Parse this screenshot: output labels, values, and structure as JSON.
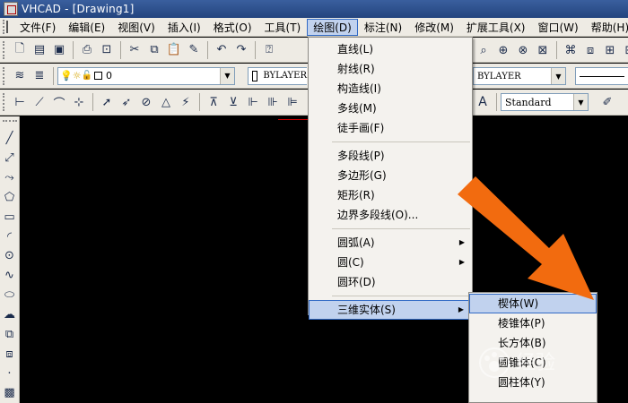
{
  "window": {
    "title": "VHCAD - [Drawing1]"
  },
  "menubar": {
    "items": [
      {
        "label": "文件(F)"
      },
      {
        "label": "编辑(E)"
      },
      {
        "label": "视图(V)"
      },
      {
        "label": "插入(I)"
      },
      {
        "label": "格式(O)"
      },
      {
        "label": "工具(T)"
      },
      {
        "label": "绘图(D)",
        "active": true
      },
      {
        "label": "标注(N)"
      },
      {
        "label": "修改(M)"
      },
      {
        "label": "扩展工具(X)"
      },
      {
        "label": "窗口(W)"
      },
      {
        "label": "帮助(H)"
      }
    ]
  },
  "toolbar2": {
    "layer_value": "0",
    "color_value": "BYLAYER",
    "linetype_value": "BYLAYER"
  },
  "toolbar3": {
    "textstyle_value": "Standard"
  },
  "draw_menu": {
    "items": [
      {
        "label": "直线(L)"
      },
      {
        "label": "射线(R)"
      },
      {
        "label": "构造线(I)"
      },
      {
        "label": "多线(M)"
      },
      {
        "label": "徒手画(F)"
      },
      {
        "label": "多段线(P)"
      },
      {
        "label": "多边形(G)"
      },
      {
        "label": "矩形(R)"
      },
      {
        "label": "边界多段线(O)..."
      },
      {
        "label": "圆弧(A)"
      },
      {
        "label": "圆(C)"
      },
      {
        "label": "圆环(D)"
      },
      {
        "label": "三维实体(S)"
      }
    ]
  },
  "solids_submenu": {
    "items": [
      {
        "label": "楔体(W)"
      },
      {
        "label": "棱锥体(P)"
      },
      {
        "label": "长方体(B)"
      },
      {
        "label": "圆锥体(C)"
      },
      {
        "label": "圆柱体(Y)"
      }
    ]
  },
  "watermark": {
    "text": "经验"
  },
  "colors": {
    "accent": "#316ac5",
    "highlight": "#c1d2ee",
    "arrow": "#f26b0f",
    "canvas": "#000000"
  }
}
